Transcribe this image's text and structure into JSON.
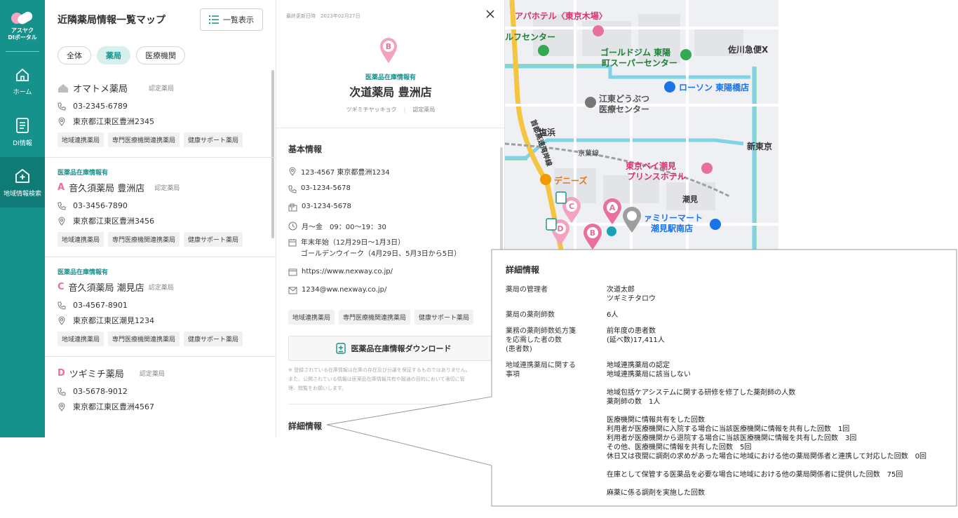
{
  "nav": {
    "logo_text_1": "アスヤク",
    "logo_text_2": "DIポータル",
    "items": [
      {
        "label": "ホーム",
        "icon": "home-icon"
      },
      {
        "label": "DI情報",
        "icon": "document-icon"
      },
      {
        "label": "地域情報検索",
        "icon": "hospital-search-icon"
      }
    ]
  },
  "list": {
    "title": "近隣薬局情報一覧マップ",
    "list_button": "一覧表示",
    "filters": [
      "全体",
      "薬局",
      "医療機関"
    ],
    "cards": [
      {
        "stock": "",
        "letter": "",
        "name": "オマトメ薬局",
        "cert": "認定薬局",
        "phone": "03-2345-6789",
        "address": "東京都江東区豊洲2345",
        "tags": [
          "地域連携薬局",
          "専門医療機関連携薬局",
          "健康サポート薬局"
        ]
      },
      {
        "stock": "医薬品在庫情報有",
        "letter": "A",
        "name": "音久須薬局 豊洲店",
        "cert": "認定薬局",
        "phone": "03-3456-7890",
        "address": "東京都江東区豊洲3456",
        "tags": [
          "地域連携薬局",
          "専門医療機関連携薬局",
          "健康サポート薬局"
        ]
      },
      {
        "stock": "医薬品在庫情報有",
        "letter": "C",
        "name": "音久須薬局 潮見店",
        "cert": "認定薬局",
        "phone": "03-4567-8901",
        "address": "東京都江東区潮見1234",
        "tags": [
          "地域連携薬局",
          "専門医療機関連携薬局",
          "健康サポート薬局"
        ]
      },
      {
        "stock": "",
        "letter": "D",
        "name": "ツギミチ薬局",
        "cert": "認定薬局",
        "phone": "03-5678-9012",
        "address": "東京都江東区豊洲4567",
        "tags": []
      }
    ]
  },
  "detail": {
    "updated": "最終更新日時　2023年02月27日",
    "pin_letter": "B",
    "stock": "医薬品在庫情報有",
    "store": "次道薬局 豊洲店",
    "kana": "ツギミチヤッキョク",
    "cert": "認定薬局",
    "basic_title": "基本情報",
    "address": "123-4567 東京都豊洲1234",
    "phone": "03-1234-5678",
    "fax": "03-1234-5678",
    "hours": "月～金　09：00～19：30",
    "holiday_1": "年末年始（12月29日～1月3日）",
    "holiday_2": "ゴールデンウイーク（4月29日、5月3日から5日）",
    "url": "https://www.nexway.co.jp/",
    "email": "1234@ww.nexway.co.jp/",
    "tags": [
      "地域連携薬局",
      "専門医療機関連携薬局",
      "健康サポート薬局"
    ],
    "download": "医薬品在庫情報ダウンロード",
    "note_1": "※ 登録されている在庫情報は在庫の存在及び分譲を保証するものではありません。",
    "note_2": "また、公開されている情報は医薬品在庫情報共有や融通の目的において適切に管",
    "note_3": "理、閲覧をお願いします。",
    "detail_title": "詳細情報"
  },
  "map": {
    "labels": [
      {
        "text": "アパホテル〈東京木場〉",
        "cls": "pink"
      },
      {
        "text": "ルフセンター",
        "cls": "green"
      },
      {
        "text": "ゴールドジム 東陽",
        "cls": "green"
      },
      {
        "text": "町スーパーセンター",
        "cls": "green"
      },
      {
        "text": "佐川急便X",
        "cls": "dark"
      },
      {
        "text": "ローソン 東陽橋店",
        "cls": "blue"
      },
      {
        "text": "江東どうぶつ",
        "cls": "gray"
      },
      {
        "text": "医療センター",
        "cls": "gray"
      },
      {
        "text": "塩浜",
        "cls": "dark"
      },
      {
        "text": "京葉線",
        "cls": "dark"
      },
      {
        "text": "新東京",
        "cls": "dark"
      },
      {
        "text": "東京ベイ潮見",
        "cls": "pink"
      },
      {
        "text": "プリンスホテル",
        "cls": "pink"
      },
      {
        "text": "デニーズ",
        "cls": "orange"
      },
      {
        "text": "潮見",
        "cls": "dark"
      },
      {
        "text": "ァミリーマート",
        "cls": "blue"
      },
      {
        "text": "潮見駅南店",
        "cls": "blue"
      },
      {
        "text": "首都高速湾岸線",
        "cls": "dark"
      }
    ],
    "pins": [
      "A",
      "B",
      "C",
      "D"
    ]
  },
  "callout": {
    "title": "詳細情報",
    "rows": [
      {
        "key": [
          "薬局の管理者"
        ],
        "value": [
          "次道太郎",
          "ツギミチタロウ"
        ]
      },
      {
        "key": [
          "薬局の薬剤師数"
        ],
        "value": [
          "6人"
        ]
      },
      {
        "key": [
          "業務の薬剤師数処方箋",
          "を応需した者の数",
          "(患者数)"
        ],
        "value": [
          "前年度の患者数",
          "(延べ数)17,411人"
        ]
      },
      {
        "key": [
          "地域連携薬局に関する",
          "事項"
        ],
        "value": [
          "地域連携薬局の認定",
          "地域連携薬局に該当しない",
          "",
          "地域包括ケアシステムに関する研修を修了した薬剤師の人数",
          "薬剤師の数　1人",
          "",
          "医療機関に情報共有をした回数",
          "利用者が医療機関に入院する場合に当該医療機関に情報を共有した回数　1回",
          "利用者が医療機関から退院する場合に当該医療機関に情報を共有した回数　3回",
          "その他、医療機関に情報を共有した回数　5回",
          "休日又は夜間に調剤の求めがあった場合に地域における他の薬局関係者と連携して対応した回数　0回",
          "",
          "在庫として保管する医薬品を必要な場合に地域における他の薬局関係者に提供した回数　75回",
          "",
          "麻薬に係る調剤を実施した回数"
        ]
      }
    ]
  },
  "colors": {
    "accent": "#17918c",
    "pink": "#e8709a"
  }
}
